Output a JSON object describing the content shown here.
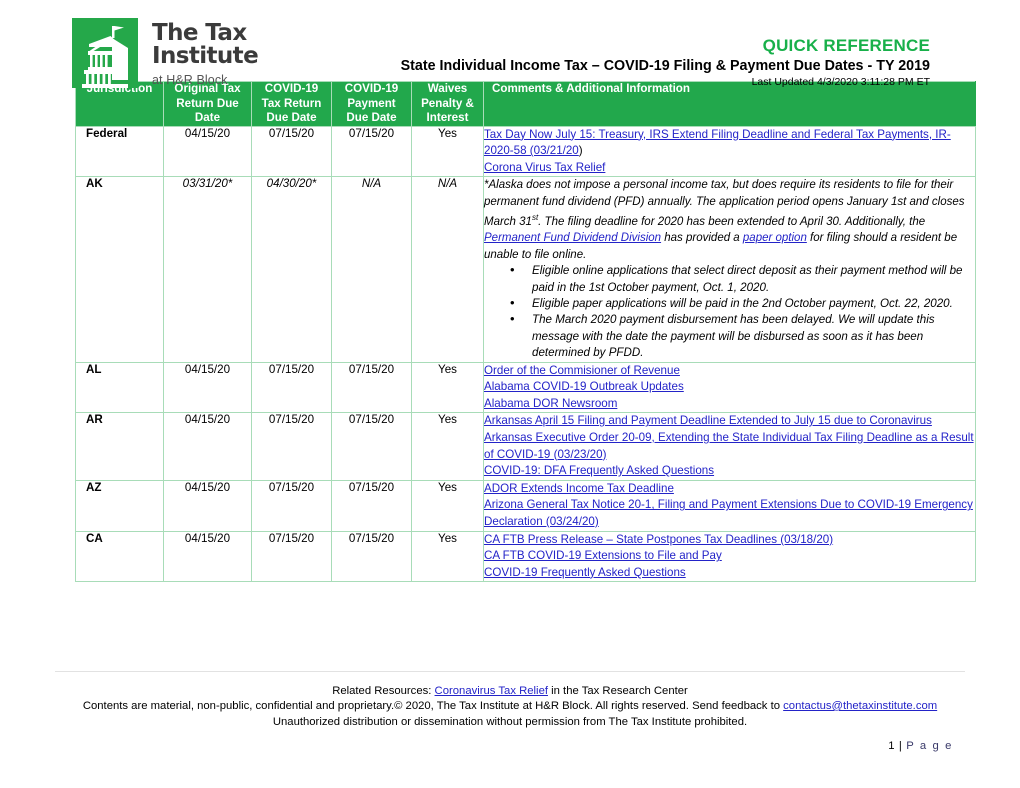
{
  "header": {
    "logo": {
      "icon": "tax-institute-building-logo",
      "line1": "The Tax",
      "line2": "Institute",
      "tagline": "at H&R Block",
      "brand_green": "#25a84a"
    },
    "quick_reference": "QUICK REFERENCE",
    "document_title": "State Individual Income Tax – COVID-19 Filing & Payment Due Dates - TY 2019",
    "last_updated": "Last Updated 4/3/2020 3:11:28 PM ET"
  },
  "table": {
    "header_bg": "#22a84c",
    "border_color": "#a8dcb8",
    "link_color": "#2323c8",
    "columns": [
      "Jurisdiction",
      "Original Tax Return Due Date",
      "COVID-19 Tax Return Due Date",
      "COVID-19 Payment Due Date",
      "Waives Penalty & Interest",
      "Comments & Additional Information"
    ],
    "columns_wrapped": [
      [
        "Jurisdiction"
      ],
      [
        "Original Tax",
        "Return Due",
        "Date"
      ],
      [
        "COVID-19",
        "Tax Return",
        "Due Date"
      ],
      [
        "COVID-19",
        "Payment",
        "Due Date"
      ],
      [
        "Waives",
        "Penalty &",
        "Interest"
      ],
      [
        "Comments & Additional Information"
      ]
    ],
    "rows": [
      {
        "jurisdiction": "Federal",
        "original_due": "04/15/20",
        "covid_return_due": "07/15/20",
        "covid_payment_due": "07/15/20",
        "waives": "Yes",
        "italic": false,
        "links": [
          "Tax Day Now July 15: Treasury, IRS Extend Filing Deadline and Federal Tax Payments, IR-2020-58 (03/21/20",
          "Corona Virus Tax Relief"
        ],
        "link_trailing": ")"
      },
      {
        "jurisdiction": "AK",
        "original_due": "03/31/20*",
        "covid_return_due": "04/30/20*",
        "covid_payment_due": "N/A",
        "waives": "N/A",
        "italic": true,
        "paragraph": {
          "part1": "*Alaska does not impose a personal income tax, but does require its residents to file for their permanent fund dividend (PFD) annually. The application period opens January 1st and closes March 31",
          "sup1": "st",
          "part2": ". The filing deadline for 2020 has been extended to April 30. Additionally, the ",
          "link1": "Permanent Fund Dividend Division",
          "part3": " has provided a ",
          "link2": "paper option",
          "part4": " for filing should a resident be unable to file online."
        },
        "bullets": [
          "Eligible online applications that select direct deposit as their payment method will be paid in the 1st October payment, Oct. 1, 2020.",
          "Eligible paper applications will be paid in the 2nd October payment, Oct. 22, 2020.",
          "The March 2020 payment disbursement has been delayed.  We will update this message with the date the payment will be disbursed as soon as it has been determined by PFDD."
        ]
      },
      {
        "jurisdiction": "AL",
        "original_due": "04/15/20",
        "covid_return_due": "07/15/20",
        "covid_payment_due": "07/15/20",
        "waives": "Yes",
        "italic": false,
        "links": [
          "Order of the Commisioner of Revenue",
          "Alabama COVID-19 Outbreak Updates",
          "Alabama DOR Newsroom"
        ]
      },
      {
        "jurisdiction": "AR",
        "original_due": "04/15/20",
        "covid_return_due": "07/15/20",
        "covid_payment_due": "07/15/20",
        "waives": "Yes",
        "italic": false,
        "links": [
          "Arkansas April 15 Filing and Payment Deadline Extended to July 15 due to Coronavirus",
          "Arkansas Executive Order 20-09, Extending the State Individual Tax Filing Deadline as a Result of COVID-19 (03/23/20)",
          "COVID-19: DFA Frequently Asked Questions"
        ]
      },
      {
        "jurisdiction": "AZ",
        "original_due": "04/15/20",
        "covid_return_due": "07/15/20",
        "covid_payment_due": "07/15/20",
        "waives": "Yes",
        "italic": false,
        "links": [
          "ADOR Extends Income Tax Deadline",
          "Arizona General Tax Notice 20-1, Filing and Payment Extensions Due to COVID-19 Emergency Declaration (03/24/20)"
        ]
      },
      {
        "jurisdiction": "CA",
        "original_due": "04/15/20",
        "covid_return_due": "07/15/20",
        "covid_payment_due": "07/15/20",
        "waives": "Yes",
        "italic": false,
        "links": [
          "CA FTB Press Release – State Postpones Tax Deadlines (03/18/20)",
          "CA FTB COVID-19 Extensions to File and Pay",
          "COVID-19 Frequently Asked Questions"
        ]
      }
    ]
  },
  "footer": {
    "related_prefix": "Related Resources: ",
    "related_link": "Coronavirus Tax Relief",
    "related_suffix": " in the Tax Research Center",
    "copyright_part1": "Contents are material, non-public, confidential and proprietary.© 2020, The Tax Institute at H&R Block. All rights reserved. Send feedback to ",
    "copyright_email": "contactus@thetaxinstitute.com",
    "unauthorized": "Unauthorized distribution or dissemination without permission from The Tax Institute prohibited.",
    "page_number": "1 | ",
    "page_word": "P a g e"
  }
}
